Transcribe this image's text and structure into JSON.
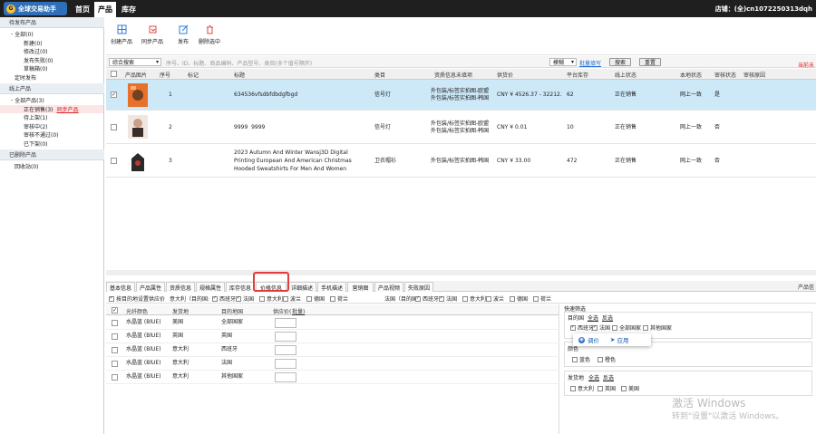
{
  "app": {
    "logo_text": "全球交易助手",
    "nav": [
      "首页",
      "产品",
      "库存"
    ],
    "active_nav": 1,
    "shop": "店铺：(全)cn1072250313dqh"
  },
  "sidebar": {
    "sections": [
      {
        "title": "待发布产品",
        "items": [
          {
            "label": "全部(0)",
            "indent": 1,
            "expand": "-"
          },
          {
            "label": "新建(0)",
            "indent": 2
          },
          {
            "label": "修改过(0)",
            "indent": 2
          },
          {
            "label": "发布失败(0)",
            "indent": 2
          },
          {
            "label": "草稿箱(0)",
            "indent": 2
          },
          {
            "label": "定时发布",
            "indent": 1
          }
        ]
      },
      {
        "title": "线上产品",
        "items": [
          {
            "label": "全部产品(3)",
            "indent": 1,
            "expand": "-"
          },
          {
            "label": "正在销售(3)",
            "indent": 2,
            "tag": "同步产品",
            "selected": true
          },
          {
            "label": "待上架(1)",
            "indent": 2
          },
          {
            "label": "审核中(2)",
            "indent": 2
          },
          {
            "label": "审核不通过(0)",
            "indent": 2
          },
          {
            "label": "已下架(0)",
            "indent": 2
          }
        ]
      },
      {
        "title": "已删除产品",
        "items": [
          {
            "label": "回收站(0)",
            "indent": 1
          }
        ]
      }
    ]
  },
  "toolbar": {
    "buttons": [
      "创建产品",
      "同步产品",
      "发布",
      "删除选中"
    ]
  },
  "search": {
    "mode": "综合搜索",
    "placeholder": "序号、ID、标题、商品编码、产品型号、类目(多个值号隔开)",
    "match": "模糊",
    "batch": "批量填写",
    "search_btn": "搜索",
    "reset_btn": "重置",
    "right_note": "当前未"
  },
  "grid": {
    "headers": [
      "产品图片",
      "序号",
      "标记",
      "标题",
      "类目",
      "资质信息未填项",
      "供货价",
      "平台库存",
      "线上状态",
      "本地状态",
      "审核状态",
      "审核原因"
    ],
    "rows": [
      {
        "idx": "1",
        "title": "634536vfsdbfdbdgfbgd",
        "category": "信号灯",
        "qual": [
          "外包装/标签实拍图-欧盟",
          "外包装/标签实拍图-韩国"
        ],
        "price": "CNY ¥ 4526.37 - 32212.",
        "stock": "62",
        "online": "正在销售",
        "local": "网上一致",
        "audit": "是",
        "selected": true,
        "img": "orange"
      },
      {
        "idx": "2",
        "title": "9999  9999",
        "category": "信号灯",
        "qual": [
          "外包装/标签实拍图-欧盟",
          "外包装/标签实拍图-韩国"
        ],
        "price": "CNY ¥ 0.01",
        "stock": "10",
        "online": "正在销售",
        "local": "网上一致",
        "audit": "否",
        "selected": false,
        "img": "pink"
      },
      {
        "idx": "3",
        "title": [
          "2023 Autumn And Winter Wansj3D Digital",
          "Printing European And American Christmas",
          "Hooded Sweatshirts For Men And Women"
        ],
        "category": "卫衣帽衫",
        "qual": [
          "外包装/标签实拍图-韩国"
        ],
        "price": "CNY ¥ 33.00",
        "stock": "472",
        "online": "正在销售",
        "local": "网上一致",
        "audit": "否",
        "selected": false,
        "img": "dark"
      }
    ]
  },
  "tabs": {
    "items": [
      "基本信息",
      "产品属性",
      "资质信息",
      "规格属性",
      "库存信息",
      "价格信息",
      "详细描述",
      "手机描述",
      "营销图",
      "产品视频",
      "失败原因"
    ],
    "active": 5,
    "right_label": "产品信"
  },
  "options": {
    "main": "按目的地设置供应价",
    "eu_label": "意大利（目的国:",
    "eu_countries": [
      {
        "n": "西班牙",
        "on": true
      },
      {
        "n": "法国",
        "on": true
      },
      {
        "n": "意大利",
        "on": false
      },
      {
        "n": "波兰",
        "on": false
      },
      {
        "n": "德国",
        "on": false
      },
      {
        "n": "荷兰",
        "on": false
      }
    ],
    "fr_label": "法国（目的国:",
    "fr_countries": [
      {
        "n": "西班牙",
        "on": true
      },
      {
        "n": "法国",
        "on": true
      },
      {
        "n": "意大利",
        "on": false
      },
      {
        "n": "波兰",
        "on": false
      },
      {
        "n": "德国",
        "on": false
      },
      {
        "n": "荷兰",
        "on": false
      }
    ]
  },
  "price_table": {
    "headers": [
      "光纤颜色",
      "发货地",
      "目的地国",
      "供应价(",
      "批量)"
    ],
    "rows": [
      {
        "color": "水晶蓝 (BlUE)",
        "ship": "美国",
        "dest": "全部国家"
      },
      {
        "color": "水晶蓝 (BlUE)",
        "ship": "英国",
        "dest": "英国"
      },
      {
        "color": "水晶蓝 (BlUE)",
        "ship": "意大利",
        "dest": "西班牙"
      },
      {
        "color": "水晶蓝 (BlUE)",
        "ship": "意大利",
        "dest": "法国"
      },
      {
        "color": "水晶蓝 (BlUE)",
        "ship": "意大利",
        "dest": "其他国家"
      }
    ]
  },
  "quick": {
    "title": "快速筛选",
    "dest_label": "目的国",
    "all": "全选",
    "invert": "反选",
    "dests": [
      {
        "n": "西班牙",
        "on": true
      },
      {
        "n": "法国",
        "on": true
      },
      {
        "n": "全部国家",
        "on": false
      },
      {
        "n": "其他国家",
        "on": false
      }
    ],
    "color_label": "颜色",
    "colors": [
      "蓝色",
      "橙色"
    ],
    "ship_label": "发货地",
    "ships": [
      "意大利",
      "英国",
      "美国"
    ],
    "popup_adjust": "调价",
    "popup_apply": "应用"
  },
  "watermark": {
    "line1": "激活 Windows",
    "line2": "转到\"设置\"以激活 Windows。"
  }
}
